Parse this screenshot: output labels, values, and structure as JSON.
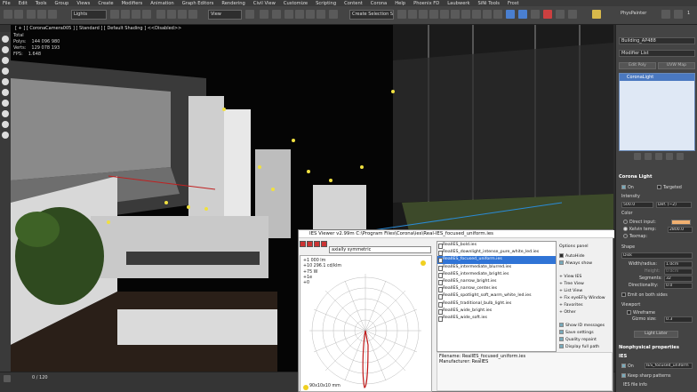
{
  "menu": {
    "items": [
      "File",
      "Edit",
      "Tools",
      "Group",
      "Views",
      "Create",
      "Modifiers",
      "Animation",
      "Graph Editors",
      "Rendering",
      "Civil View",
      "Customize",
      "Scripting",
      "Content",
      "Corona",
      "Help",
      "Phoenix FD",
      "Laubwerk",
      "SiNi Tools",
      "Frost"
    ]
  },
  "toolbar": {
    "selection_filter": "Lights",
    "ref_coord": "View",
    "named_selection": "Create Selection Se",
    "phys_painter": "PhysPainter",
    "stat_num": "1"
  },
  "viewport": {
    "label": "[ + ] [ CoronaCamera005 ] [ Standard ] [ Default Shading ]  <<Disabled>>",
    "stats": [
      {
        "key": "Total",
        "value": ""
      },
      {
        "key": "Polys:",
        "value": "144 096 980"
      },
      {
        "key": "Verts:",
        "value": "129 078 193"
      },
      {
        "key": "FPS:",
        "value": "1.648"
      }
    ]
  },
  "command_panel": {
    "object_name": "Building_AP488",
    "modifier_list": "Modifier List",
    "edit_poly": "Edit Poly",
    "uvw_map": "UVW Map",
    "stack_item": "CoronaLight",
    "rollout_title": "Corona Light",
    "on_label": "On",
    "targeted_label": "Targeted",
    "intensity_label": "Intensity",
    "intensity_value": "500.0",
    "intensity_unit": "Def. (~2)",
    "color_label": "Color",
    "direct_input": "Direct input:",
    "kelvin_temp": "Kelvin temp:",
    "kelvin_value": "2800.0",
    "texmap": "Texmap:",
    "shape_label": "Shape",
    "shape_value": "Disk",
    "width_label": "Width/radius:",
    "width_value": "1.0cm",
    "height_label": "Height:",
    "height_value": "0.0cm",
    "segments_label": "Segments:",
    "segments_value": "32",
    "directionality_label": "Directionality:",
    "directionality_value": "0.0",
    "emit_both": "Emit on both sides",
    "viewport_label": "Viewport",
    "wireframe": "Wireframe",
    "gizmo_label": "Gizmo size:",
    "gizmo_value": "0.3",
    "lister_btn": "Light Lister",
    "nonphys": "Nonphysical properties",
    "ies_head": "IES",
    "ies_on": "On",
    "ies_file": "IES_focused_uniform",
    "keep_sharp": "Keep sharp patterns",
    "ies_file_info": "IES file info"
  },
  "timeline": {
    "frame": "0 / 120"
  },
  "ies_viewer": {
    "title": "IES Viewer v2.99m   C:\\Program Files\\Corona\\ies\\Real-IES_focused_uniform.ies",
    "symmetry": "axially symmetric",
    "legend": [
      "+1 000 lm",
      "+10 296.1 cd/klm",
      "+75 W",
      "+1e",
      "+0"
    ],
    "bottom_dims": "90x10x10 mm",
    "files": [
      "RealIES_bold.ies",
      "RealIES_downlight_intense_pure_white_led.ies",
      "RealIES_focused_uniform.ies",
      "RealIES_intermediate_blurred.ies",
      "RealIES_intermediate_bright.ies",
      "RealIES_narrow_bright.ies",
      "RealIES_narrow_center.ies",
      "RealIES_spotlight_soft_warm_white_led.ies",
      "RealIES_traditional_bulb_light.ies",
      "RealIES_wide_bright.ies",
      "RealIES_wide_soft.ies"
    ],
    "selected_index": 2,
    "options": {
      "panel_label": "Options panel",
      "autohide": "AutoHide",
      "always_show": "Always show",
      "view_ies": "+ View IES",
      "tree_view": "+ Tree View",
      "list_view": "+ List View",
      "fixture_view": "+ Fix eyeEFly Window",
      "favorites": "+ Favorites",
      "other": "+ Other",
      "show_ids": "Show ID messages",
      "save_settings": "Save settings",
      "quality_repaint": "Quality repaint",
      "display_full": "Display full path"
    },
    "info": {
      "filename": "Filename: RealIES_focused_uniform.ies",
      "manufacturer": "Manufacturer: RealIES"
    }
  }
}
